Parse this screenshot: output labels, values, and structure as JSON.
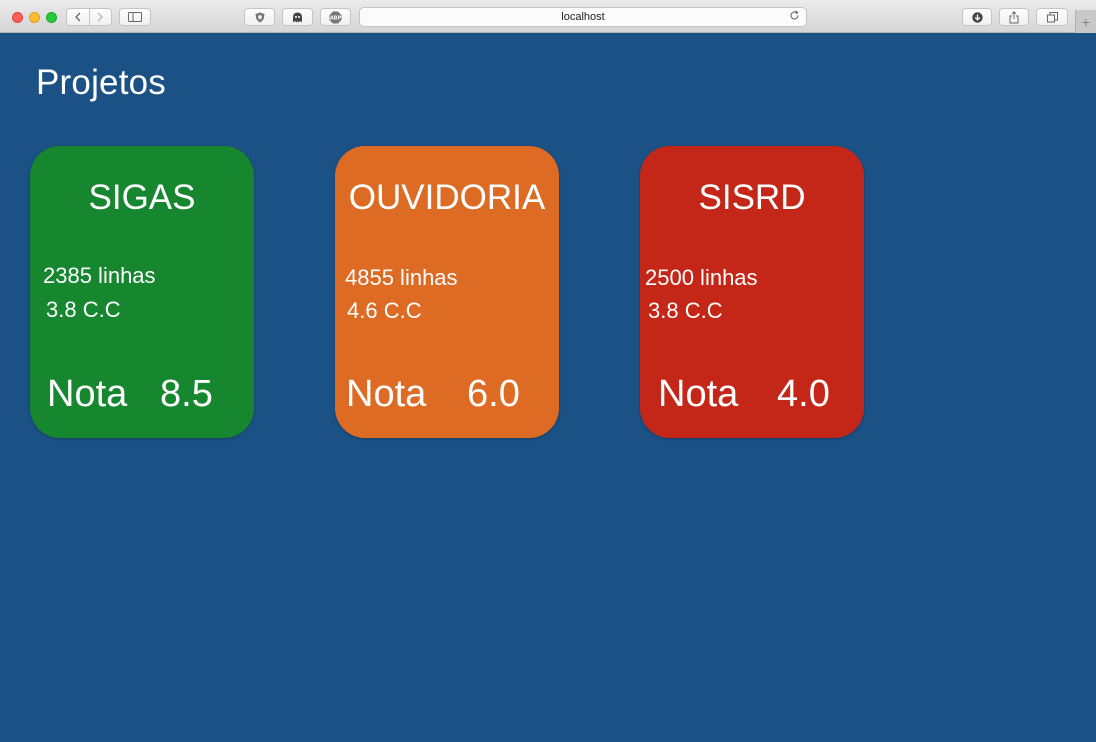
{
  "browser": {
    "url": "localhost",
    "new_tab_label": "+"
  },
  "page": {
    "title": "Projetos",
    "grade_label": "Nota"
  },
  "colors": {
    "background": "#1c5186",
    "green": "#16872f",
    "orange": "#de6b23",
    "red": "#c42718"
  },
  "projects": [
    {
      "name": "SIGAS",
      "lines": "2385 linhas",
      "cc": "3.8 C.C",
      "grade": "8.5",
      "color": "#16872f"
    },
    {
      "name": "OUVIDORIA",
      "lines": "4855 linhas",
      "cc": "4.6 C.C",
      "grade": "6.0",
      "color": "#de6b23"
    },
    {
      "name": "SISRD",
      "lines": "2500 linhas",
      "cc": "3.8 C.C",
      "grade": "4.0",
      "color": "#c42718"
    }
  ]
}
